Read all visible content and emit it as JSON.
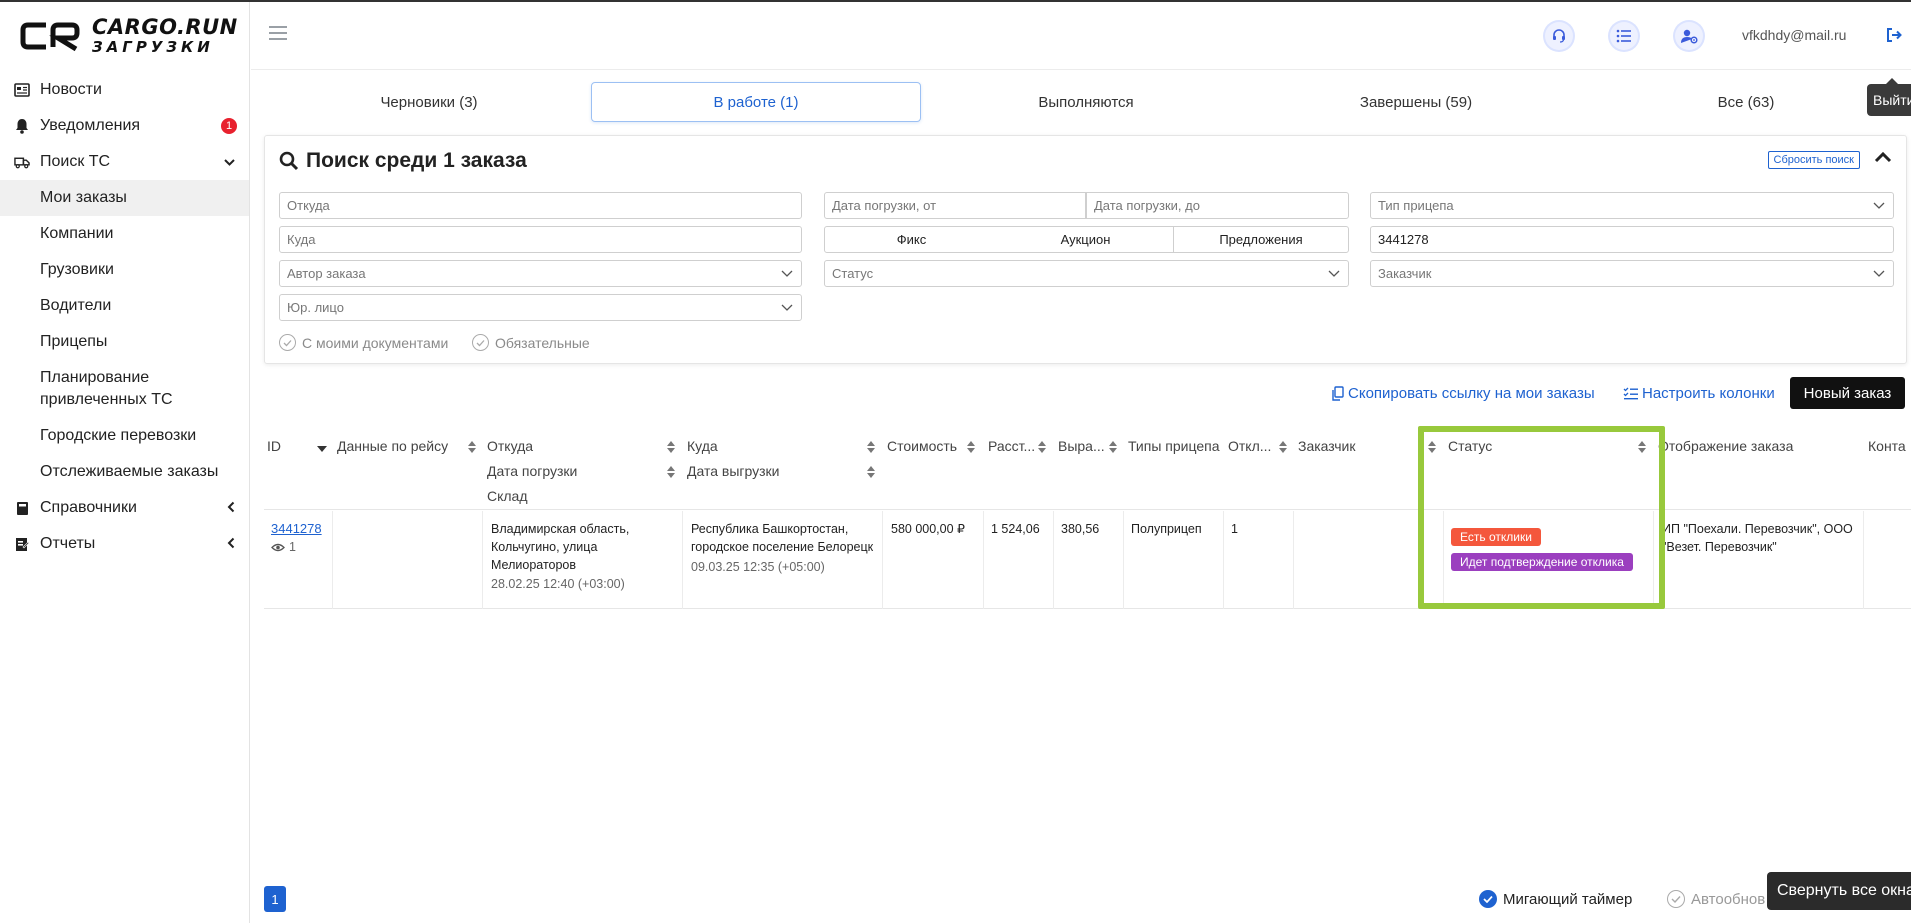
{
  "brand": {
    "line1": "CARGO.RUN",
    "line2": "ЗАГРУЗКИ"
  },
  "sidebar": {
    "items": [
      {
        "label": "Новости",
        "icon": "newspaper-icon"
      },
      {
        "label": "Уведомления",
        "icon": "bell-icon",
        "badge": "1"
      },
      {
        "label": "Поиск ТС",
        "icon": "truck-icon"
      },
      {
        "label": "Мои заказы"
      },
      {
        "label": "Компании"
      },
      {
        "label": "Грузовики"
      },
      {
        "label": "Водители"
      },
      {
        "label": "Прицепы"
      },
      {
        "label": "Планирование привлеченных ТС"
      },
      {
        "label": "Городские перевозки"
      },
      {
        "label": "Отслеживаемые заказы"
      },
      {
        "label": "Справочники",
        "icon": "book-icon"
      },
      {
        "label": "Отчеты",
        "icon": "report-icon"
      }
    ]
  },
  "header": {
    "user_email": "vfkdhdy@mail.ru",
    "exit_tooltip": "Выйти"
  },
  "tabs": [
    "Черновики (3)",
    "В работе (1)",
    "Выполняются",
    "Завершены (59)",
    "Все (63)"
  ],
  "search": {
    "title": "Поиск среди 1 заказа",
    "reset_label": "Сбросить поиск",
    "from_placeholder": "Откуда",
    "to_placeholder": "Куда",
    "author_placeholder": "Автор заказа",
    "legal_placeholder": "Юр. лицо",
    "date_from_placeholder": "Дата погрузки, от",
    "date_to_placeholder": "Дата погрузки, до",
    "seg_fixed": "Фикс",
    "seg_auction": "Аукцион",
    "seg_offers": "Предложения",
    "status_placeholder": "Статус",
    "trailer_placeholder": "Тип прицепа",
    "order_id_value": "3441278",
    "customer_placeholder": "Заказчик",
    "check_docs": "С моими документами",
    "check_required": "Обязательные"
  },
  "actions": {
    "copy_link": "Скопировать ссылку на мои заказы",
    "columns": "Настроить колонки",
    "new_order": "Новый заказ"
  },
  "table": {
    "headers": {
      "id": "ID",
      "trip": "Данные по рейсу",
      "from": "Откуда",
      "load_date": "Дата погрузки",
      "warehouse": "Склад",
      "to": "Куда",
      "unload_date": "Дата выгрузки",
      "cost": "Стоимость",
      "distance": "Расст...",
      "revenue": "Выра...",
      "trailer": "Типы прицепа",
      "responses": "Откл...",
      "customer": "Заказчик",
      "status": "Статус",
      "display": "Отображение заказа",
      "contacts": "Конта"
    },
    "row": {
      "id": "3441278",
      "views": "1",
      "from": "Владимирская область, Кольчугино, улица Мелиораторов",
      "load_date": "28.02.25 12:40 (+03:00)",
      "to": "Республика Башкортостан, городское поселение Белорецк",
      "unload_date": "09.03.25 12:35 (+05:00)",
      "cost": "580 000,00 ₽",
      "distance": "1 524,06",
      "revenue": "380,56",
      "trailer": "Полуприцеп",
      "responses": "1",
      "status_1": "Есть отклики",
      "status_2": "Идет подтверждение отклика",
      "display": "ИП \"Поехали. Перевозчик\", ООО \"Везет. Перевозчик\""
    }
  },
  "footer": {
    "page": "1",
    "blink_timer": "Мигающий таймер",
    "auto_update": "Автообнов",
    "collapse_all": "Свернуть все окна"
  },
  "colors": {
    "accent": "#1e62d0",
    "status_responses": "#f4573c",
    "status_confirming": "#9b3fbf",
    "highlight": "#98c93c"
  }
}
